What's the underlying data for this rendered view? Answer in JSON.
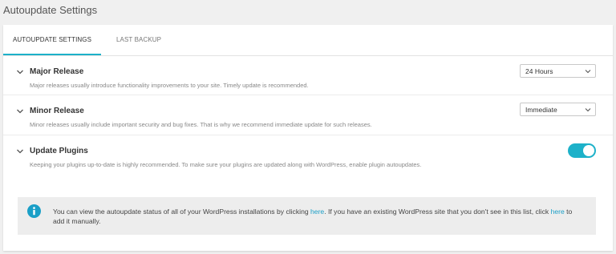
{
  "page": {
    "title": "Autoupdate Settings"
  },
  "tabs": [
    {
      "label": "AUTOUPDATE SETTINGS",
      "active": true
    },
    {
      "label": "LAST BACKUP",
      "active": false
    }
  ],
  "settings": [
    {
      "title": "Major Release",
      "description": "Major releases usually introduce functionality improvements to your site. Timely update is recommended.",
      "control": "select",
      "value": "24 Hours"
    },
    {
      "title": "Minor Release",
      "description": "Minor releases usually include important security and bug fixes. That is why we recommend immediate update for such releases.",
      "control": "select",
      "value": "Immediate"
    },
    {
      "title": "Update Plugins",
      "description": "Keeping your plugins up-to-date is highly recommended. To make sure your plugins are updated along with WordPress, enable plugin autoupdates.",
      "control": "toggle",
      "enabled": true
    }
  ],
  "notice": {
    "text_1": "You can view the autoupdate status of all of your WordPress installations by clicking ",
    "link_1": "here",
    "text_2": ". If you have an existing WordPress site that you don't see in this list, click ",
    "link_2": "here",
    "text_3": " to add it manually."
  },
  "colors": {
    "accent": "#1db1c9",
    "link": "#1a9fc7",
    "info_icon": "#1a9fc7",
    "notice_bg": "#ededed"
  },
  "icons": {
    "row_chevron": "chevron-down-icon",
    "select_arrow": "chevron-down-icon",
    "notice": "info-icon"
  }
}
